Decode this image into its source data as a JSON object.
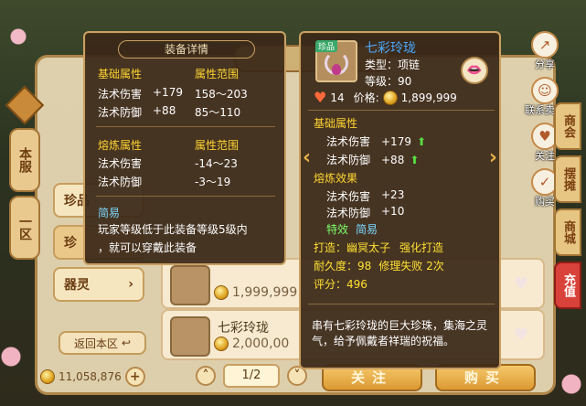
{
  "background": {
    "left_tabs": [
      "本服",
      "一区"
    ],
    "categories": [
      {
        "label": "珍品",
        "arrow": ""
      },
      {
        "label": "珍",
        "arrow": ""
      },
      {
        "label": "器灵",
        "arrow": "›"
      }
    ],
    "return_label": "返回本区",
    "money": "11,058,876",
    "page": "1/2",
    "listings": [
      {
        "name": "",
        "price": "1,999,999"
      },
      {
        "name": "七彩玲珑",
        "price": "2,000,00"
      }
    ],
    "follow_label": "关注",
    "buy_label": "购买",
    "right_actions": [
      {
        "icon": "share-icon",
        "symbol": "↗",
        "label": "分享"
      },
      {
        "icon": "contact-seller-icon",
        "symbol": "☺",
        "label": "联系卖家"
      },
      {
        "icon": "follow-icon",
        "symbol": "♥",
        "label": "关注"
      },
      {
        "icon": "purchase-icon",
        "symbol": "✓",
        "label": "购买"
      }
    ],
    "right_tabs": [
      "商会",
      "摆摊",
      "商城",
      "充值"
    ]
  },
  "detail_popup": {
    "header": "装备详情",
    "base_title": "基础属性",
    "base_range_title": "属性范围",
    "base_rows": [
      {
        "name": "法术伤害",
        "value": "+179",
        "range": "158～203"
      },
      {
        "name": "法术防御",
        "value": "+88",
        "range": "85～110"
      }
    ],
    "forge_title": "熔炼属性",
    "forge_range_title": "属性范围",
    "forge_rows": [
      {
        "name": "法术伤害",
        "range": "-14～23"
      },
      {
        "name": "法术防御",
        "range": "-3～19"
      }
    ],
    "easy_title": "简易",
    "easy_desc_line1": "玩家等级低于此装备等级5级内",
    "easy_desc_line2": "，就可以穿戴此装备"
  },
  "item_popup": {
    "icon_tag": "珍品",
    "name": "七彩玲珑",
    "type_line": "类型：项链",
    "level_line": "等级：90",
    "likes": "14",
    "price_label": "价格:",
    "price": "1,899,999",
    "base_title": "基础属性",
    "base_rows": [
      {
        "name": "法术伤害",
        "value": "+179"
      },
      {
        "name": "法术防御",
        "value": "+88"
      }
    ],
    "forge_title": "熔炼效果",
    "forge_rows": [
      {
        "name": "法术伤害",
        "value": "+23"
      },
      {
        "name": "法术防御",
        "value": "+10"
      }
    ],
    "effect_label": "特效",
    "effect_value": "简易",
    "forge_by": "打造：幽冥太子",
    "forge_type": "强化打造",
    "durability": "耐久度：98",
    "repair_fail": "修理失败 2次",
    "score": "评分：496",
    "description": "串有七彩玲珑的巨大珍珠，集海之灵气，给予佩戴者祥瑞的祝福。"
  },
  "colors": {
    "popup_bg": "#3a2818",
    "popup_border": "#c8a063",
    "section_title": "#ffd431",
    "green": "#7cff6a",
    "blue": "#7ad8ff",
    "item_name": "#4aa8ff"
  }
}
